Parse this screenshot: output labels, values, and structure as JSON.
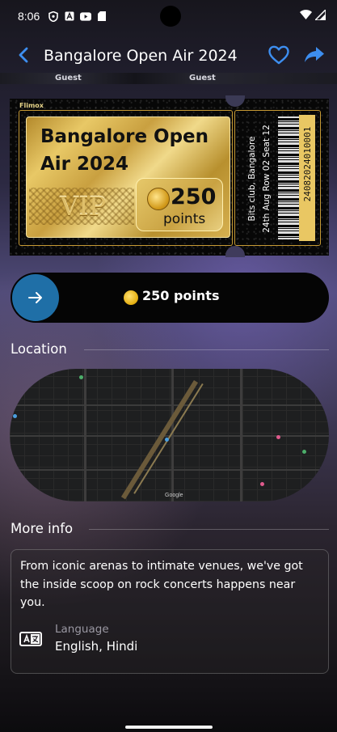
{
  "status_bar": {
    "time": "8:06",
    "icons": [
      "shield-icon",
      "a-icon",
      "youtube-icon",
      "sd-card-icon",
      "wifi-icon",
      "signal-icon"
    ]
  },
  "header": {
    "title": "Bangalore Open Air 2024",
    "icons": [
      "back-arrow-icon",
      "heart-icon",
      "share-icon"
    ],
    "accent_color": "#3d8ef0"
  },
  "guest_strip": {
    "labels": [
      "Guest",
      "Guest"
    ]
  },
  "ticket": {
    "brand": "Flimox",
    "event_name": "Bangalore Open Air 2024",
    "tier": "VIP",
    "points_value": "250",
    "points_label": "points",
    "venue": "Bits club, Bangalore",
    "details": "24th Aug   Row 02   Seat 12",
    "barcode_number": "24082024010001",
    "gold_color": "#d6b050"
  },
  "slide_to_redeem": {
    "label": "250 points",
    "knob_color": "#1f6fa7",
    "icons": [
      "arrow-right-icon",
      "coin-icon"
    ]
  },
  "location": {
    "title": "Location",
    "map_wordmark": "Google"
  },
  "more_info": {
    "title": "More info",
    "description": "From iconic arenas to intimate venues, we've got the inside scoop on rock concerts happens near you.",
    "language_label": "Language",
    "language_value": "English, Hindi",
    "icons": [
      "language-translate-icon"
    ]
  }
}
